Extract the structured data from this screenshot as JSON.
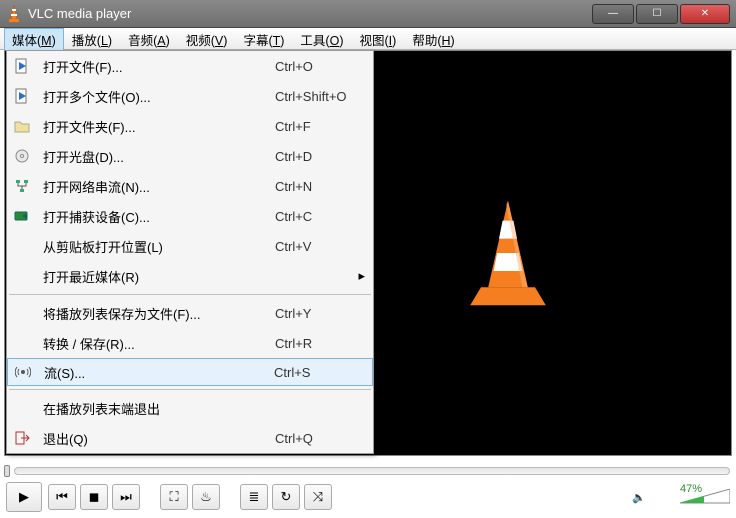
{
  "window": {
    "title": "VLC media player",
    "buttons": {
      "min": "—",
      "max": "☐",
      "close": "✕"
    }
  },
  "menubar": [
    {
      "label": "媒体",
      "key": "M",
      "open": true
    },
    {
      "label": "播放",
      "key": "L"
    },
    {
      "label": "音频",
      "key": "A"
    },
    {
      "label": "视频",
      "key": "V"
    },
    {
      "label": "字幕",
      "key": "T"
    },
    {
      "label": "工具",
      "key": "O"
    },
    {
      "label": "视图",
      "key": "I"
    },
    {
      "label": "帮助",
      "key": "H"
    }
  ],
  "dropdown": {
    "groups": [
      [
        {
          "icon": "file-play-icon",
          "label": "打开文件(F)...",
          "shortcut": "Ctrl+O"
        },
        {
          "icon": "file-play-icon",
          "label": "打开多个文件(O)...",
          "shortcut": "Ctrl+Shift+O"
        },
        {
          "icon": "folder-icon",
          "label": "打开文件夹(F)...",
          "shortcut": "Ctrl+F"
        },
        {
          "icon": "disc-icon",
          "label": "打开光盘(D)...",
          "shortcut": "Ctrl+D"
        },
        {
          "icon": "network-icon",
          "label": "打开网络串流(N)...",
          "shortcut": "Ctrl+N"
        },
        {
          "icon": "capture-icon",
          "label": "打开捕获设备(C)...",
          "shortcut": "Ctrl+C"
        },
        {
          "icon": "",
          "label": "从剪贴板打开位置(L)",
          "shortcut": "Ctrl+V"
        },
        {
          "icon": "",
          "label": "打开最近媒体(R)",
          "shortcut": "",
          "submenu": true
        }
      ],
      [
        {
          "icon": "",
          "label": "将播放列表保存为文件(F)...",
          "shortcut": "Ctrl+Y"
        },
        {
          "icon": "",
          "label": "转换 / 保存(R)...",
          "shortcut": "Ctrl+R"
        },
        {
          "icon": "stream-icon",
          "label": "流(S)...",
          "shortcut": "Ctrl+S",
          "hover": true
        }
      ],
      [
        {
          "icon": "",
          "label": "在播放列表末端退出",
          "shortcut": ""
        },
        {
          "icon": "exit-icon",
          "label": "退出(Q)",
          "shortcut": "Ctrl+Q"
        }
      ]
    ]
  },
  "controls": {
    "play": "▶",
    "prev": "⏮",
    "stop": "◼",
    "next": "⏭",
    "fullscreen": "⛶",
    "eq": "♨",
    "playlist": "≣",
    "loop": "↻",
    "shuffle": "⤨",
    "volume_icon": "🔈",
    "volume_pct": "47%"
  }
}
